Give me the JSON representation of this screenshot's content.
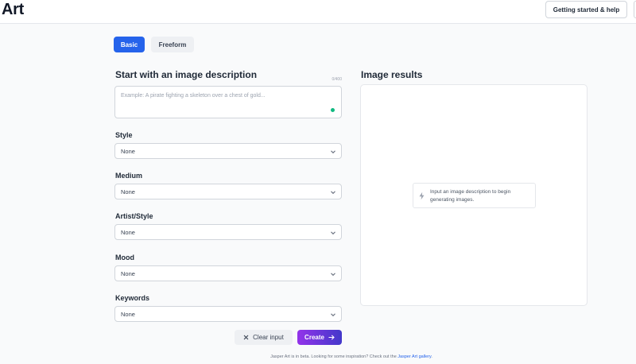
{
  "app": {
    "title": "Art",
    "help_button": "Getting started & help"
  },
  "tabs": [
    {
      "label": "Basic",
      "active": true
    },
    {
      "label": "Freeform",
      "active": false
    }
  ],
  "description": {
    "heading": "Start with an image description",
    "counter": "0/400",
    "placeholder": "Example: A pirate fighting a skeleton over a chest of gold..."
  },
  "fields": [
    {
      "label": "Style",
      "value": "None"
    },
    {
      "label": "Medium",
      "value": "None"
    },
    {
      "label": "Artist/Style",
      "value": "None"
    },
    {
      "label": "Mood",
      "value": "None"
    },
    {
      "label": "Keywords",
      "value": "None"
    }
  ],
  "results": {
    "heading": "Image results",
    "hint": "Input an image description to begin generating images.",
    "hint_icon": "lightning-icon"
  },
  "actions": {
    "clear_label": "Clear input",
    "create_label": "Create"
  },
  "footer": {
    "text": "Jasper Art is in beta. Looking for some inspiration? Check out the ",
    "link_text": "Jasper Art gallery",
    "suffix": "."
  },
  "colors": {
    "primary": "#2563eb",
    "create_gradient_start": "#9333ea",
    "create_gradient_end": "#4338ca",
    "status_dot": "#10b981"
  }
}
